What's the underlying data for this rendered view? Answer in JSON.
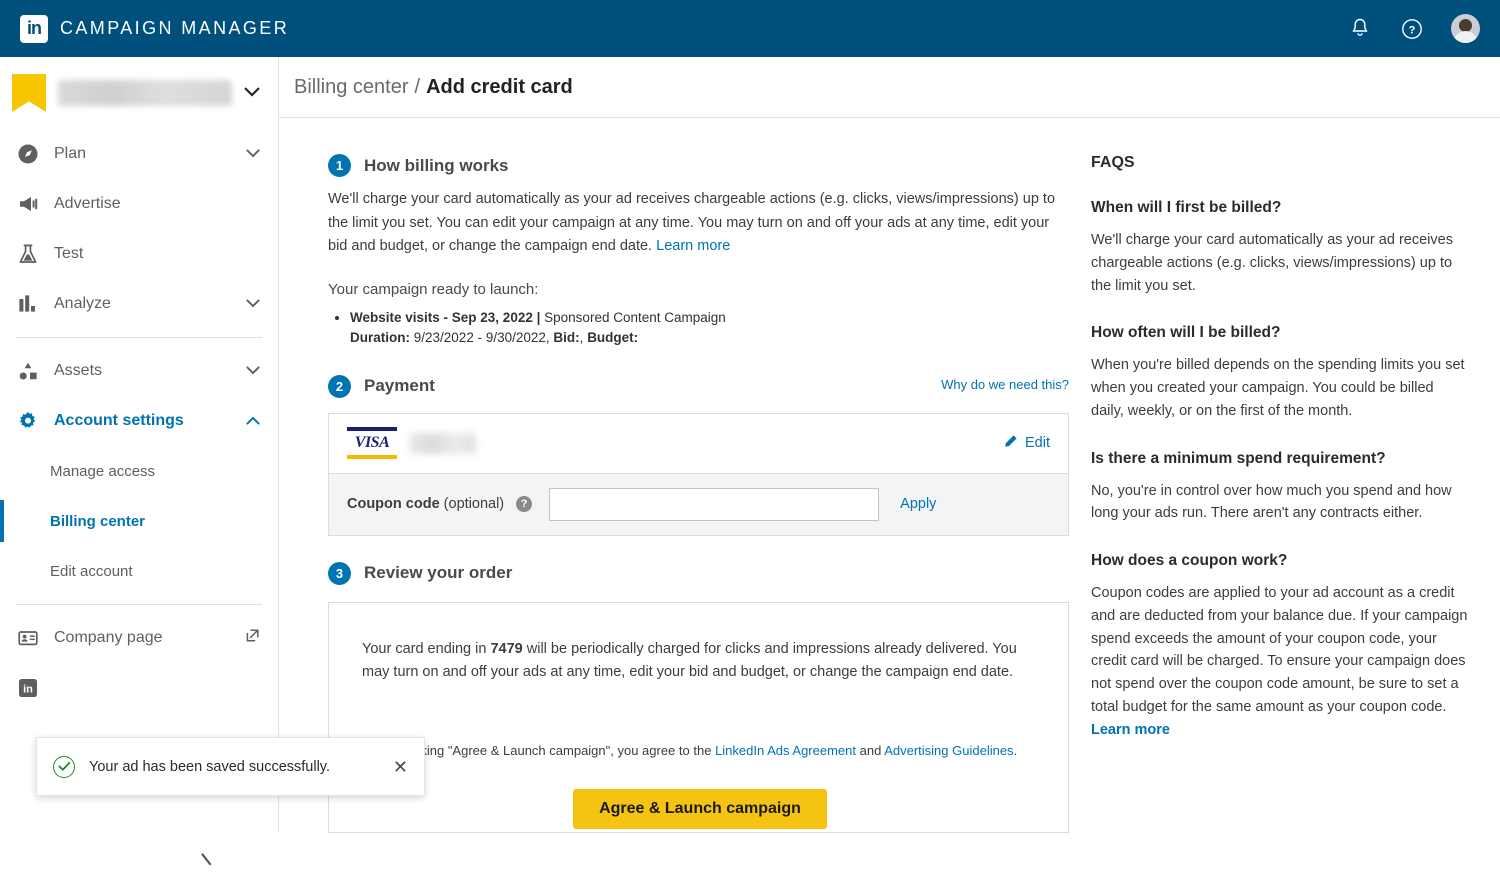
{
  "topbar": {
    "logo_text": "in",
    "brand": "CAMPAIGN MANAGER",
    "icons": {
      "notifications": "bell-icon",
      "help": "question-circle-icon",
      "avatar": "user-avatar"
    },
    "brand_color": "#00507d"
  },
  "sidebar": {
    "account": {
      "name": "",
      "blurred": true,
      "flag_color": "#f8c600"
    },
    "items": [
      {
        "label": "Plan",
        "icon": "compass-icon",
        "expandable": true,
        "active": false
      },
      {
        "label": "Advertise",
        "icon": "megaphone-icon",
        "expandable": false,
        "active": false
      },
      {
        "label": "Test",
        "icon": "flask-icon",
        "expandable": false,
        "active": false
      },
      {
        "label": "Analyze",
        "icon": "bar-chart-icon",
        "expandable": true,
        "active": false
      },
      {
        "label": "Assets",
        "icon": "shapes-icon",
        "expandable": true,
        "active": false
      },
      {
        "label": "Account settings",
        "icon": "gear-icon",
        "expandable": true,
        "active": true
      }
    ],
    "subitems": [
      {
        "label": "Manage access",
        "current": false
      },
      {
        "label": "Billing center",
        "current": true
      },
      {
        "label": "Edit account",
        "current": false
      }
    ],
    "footer": [
      {
        "label": "Company page",
        "icon": "company-page-icon",
        "external": true
      }
    ],
    "active_color": "#0073b1"
  },
  "breadcrumb": {
    "parent": "Billing center",
    "separator": "/",
    "current": "Add credit card"
  },
  "steps": {
    "one": {
      "number": "1",
      "title": "How billing works",
      "paragraph": "We'll charge your card automatically as your ad receives chargeable actions (e.g. clicks, views/impressions) up to the limit you set. You can edit your campaign at any time. You may turn on and off your ads at any time, edit your bid and budget, or change the campaign end date.",
      "learn_more": "Learn more",
      "ready_label": "Your campaign ready to launch:",
      "campaign": {
        "name": "Website visits - Sep 23, 2022",
        "pipe": "|",
        "type": "Sponsored Content Campaign",
        "duration_label": "Duration:",
        "duration_value": "9/23/2022 - 9/30/2022,",
        "bid_label": "Bid:",
        "bid_value": ",",
        "budget_label": "Budget:",
        "budget_value": ""
      }
    },
    "two": {
      "number": "2",
      "title": "Payment",
      "why_link": "Why do we need this?",
      "card_brand": "VISA",
      "card_number_masked": "",
      "edit_label": "Edit",
      "edit_icon": "pencil-icon",
      "coupon_label_bold": "Coupon code",
      "coupon_label_rest": "(optional)",
      "coupon_help_icon": "question-mark-icon",
      "coupon_value": "",
      "coupon_placeholder": "",
      "apply_label": "Apply"
    },
    "three": {
      "number": "3",
      "title": "Review your order",
      "review_pre": "Your card ending in ",
      "review_card_last4": "7479",
      "review_post": " will be periodically charged for clicks and impressions already delivered. You may turn on and off your ads at any time, edit your bid and budget, or change the campaign end date.",
      "agree_pre": "By clicking \"Agree & Launch campaign\", you agree to the ",
      "agree_link1": "LinkedIn Ads Agreement",
      "agree_mid": " and ",
      "agree_link2": "Advertising Guidelines",
      "agree_end": ".",
      "launch_button": "Agree & Launch campaign",
      "launch_color": "#f5c312"
    }
  },
  "faqs": {
    "title": "FAQS",
    "items": [
      {
        "question": "When will I first be billed?",
        "answer": "We'll charge your card automatically as your ad receives chargeable actions (e.g. clicks, views/impressions) up to the limit you set."
      },
      {
        "question": "How often will I be billed?",
        "answer": "When you're billed depends on the spending limits you set when you created your campaign. You could be billed daily, weekly, or on the first of the month."
      },
      {
        "question": "Is there a minimum spend requirement?",
        "answer": "No, you're in control over how much you spend and how long your ads run. There aren't any contracts either."
      },
      {
        "question": "How does a coupon work?",
        "answer": "Coupon codes are applied to your ad account as a credit and are deducted from your balance due. If your campaign spend exceeds the amount of your coupon code, your credit card will be charged. To ensure your campaign does not spend over the coupon code amount, be sure to set a total budget for the same amount as your coupon code.",
        "learn_more": "Learn more"
      }
    ]
  },
  "toast": {
    "message": "Your ad has been saved successfully.",
    "icon": "check-circle-icon",
    "close_icon": "close-icon",
    "accent": "#1a8a28"
  }
}
